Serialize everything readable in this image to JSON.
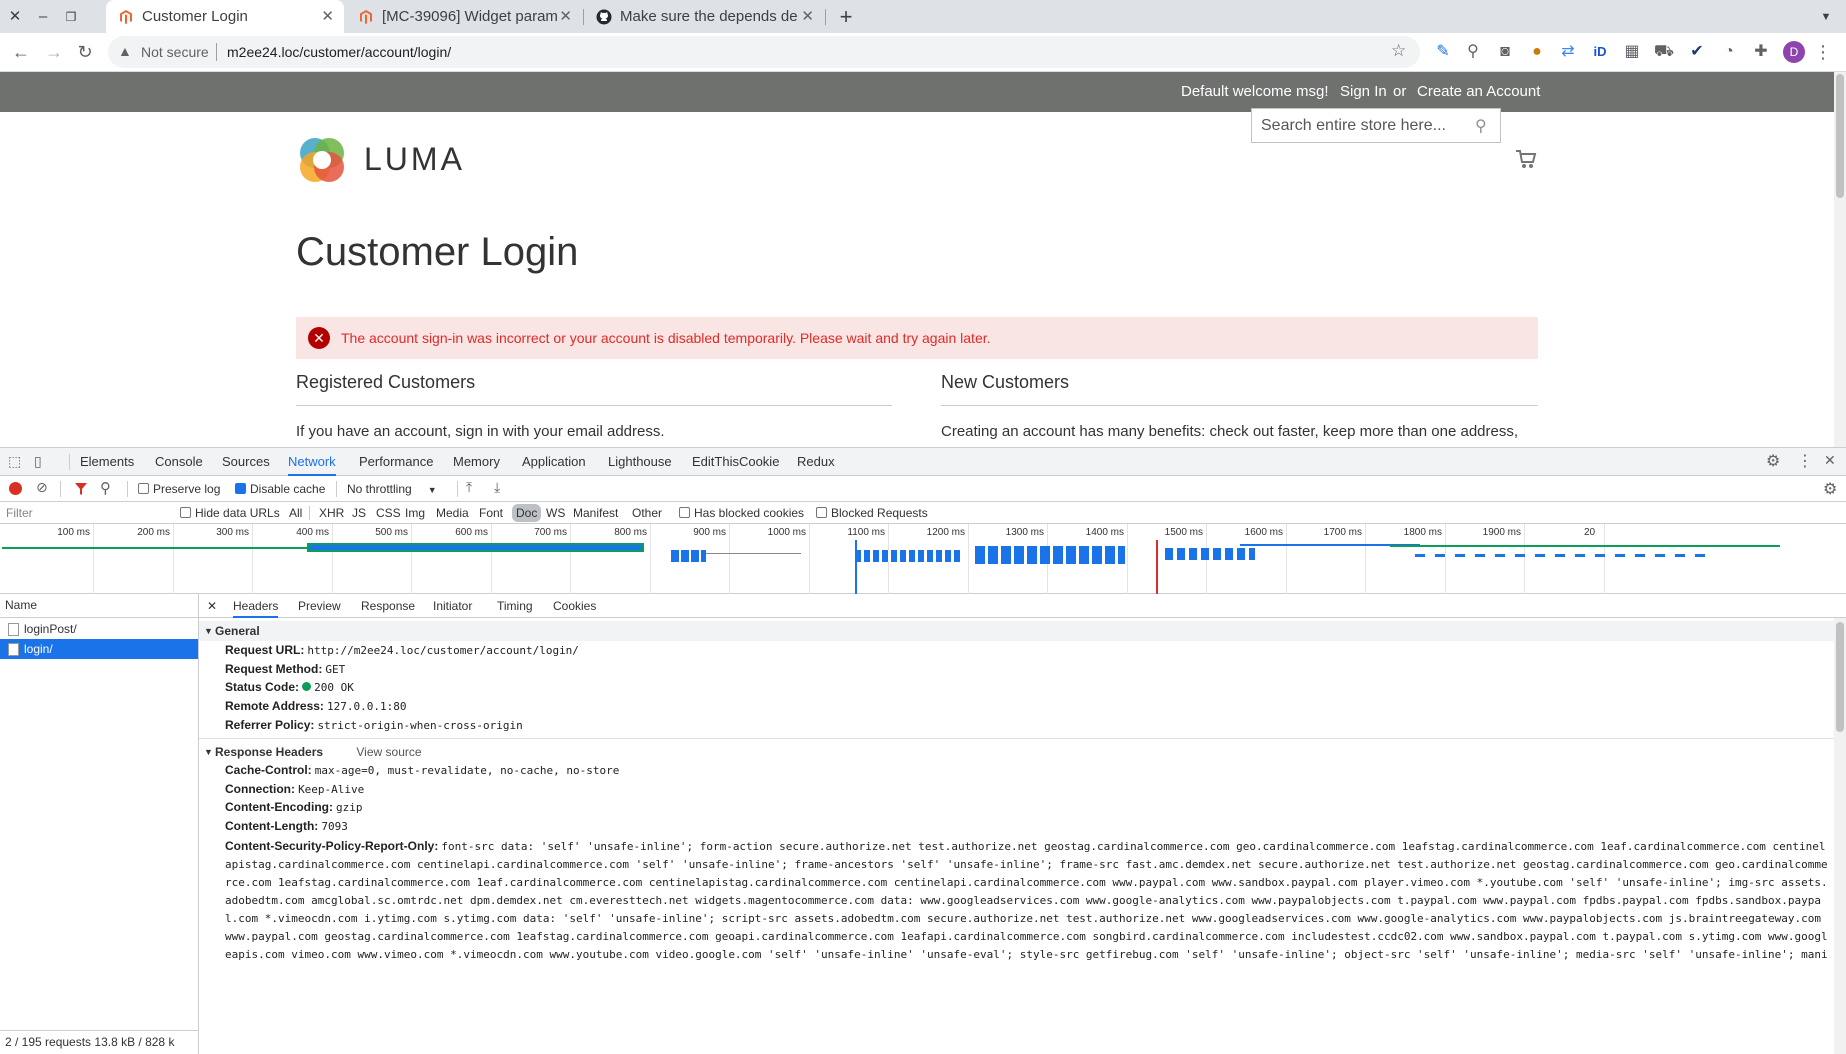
{
  "browser": {
    "tabs": [
      {
        "title": "Customer Login"
      },
      {
        "title": "[MC-39096] Widget param"
      },
      {
        "title": "Make sure the depends de"
      }
    ],
    "new_tab": "+",
    "security_label": "Not secure",
    "url": "m2ee24.loc/customer/account/login/",
    "profile_initial": "D"
  },
  "page": {
    "panel": {
      "welcome": "Default welcome msg!",
      "sign_in": "Sign In",
      "or": "or",
      "create_account": "Create an Account"
    },
    "logo_text": "LUMA",
    "search_placeholder": "Search entire store here...",
    "title": "Customer Login",
    "error_message": "The account sign-in was incorrect or your account is disabled temporarily. Please wait and try again later.",
    "registered": {
      "title": "Registered Customers",
      "text": "If you have an account, sign in with your email address."
    },
    "new_customers": {
      "title": "New Customers",
      "text": "Creating an account has many benefits: check out faster, keep more than one address,"
    }
  },
  "devtools": {
    "tabs": [
      "Elements",
      "Console",
      "Sources",
      "Network",
      "Performance",
      "Memory",
      "Application",
      "Lighthouse",
      "EditThisCookie",
      "Redux"
    ],
    "active_tab": "Network",
    "toolbar": {
      "preserve_log": "Preserve log",
      "disable_cache": "Disable cache",
      "throttling": "No throttling"
    },
    "filter": {
      "placeholder": "Filter",
      "hide_data_urls": "Hide data URLs",
      "types": [
        "All",
        "XHR",
        "JS",
        "CSS",
        "Img",
        "Media",
        "Font",
        "Doc",
        "WS",
        "Manifest",
        "Other"
      ],
      "active_type": "Doc",
      "has_blocked_cookies": "Has blocked cookies",
      "blocked_requests": "Blocked Requests"
    },
    "timeline_ticks": [
      "100 ms",
      "200 ms",
      "300 ms",
      "400 ms",
      "500 ms",
      "600 ms",
      "700 ms",
      "800 ms",
      "900 ms",
      "1000 ms",
      "1100 ms",
      "1200 ms",
      "1300 ms",
      "1400 ms",
      "1500 ms",
      "1600 ms",
      "1700 ms",
      "1800 ms",
      "1900 ms",
      "20"
    ],
    "name_header": "Name",
    "requests": [
      "loginPost/",
      "login/"
    ],
    "selected_request": "login/",
    "status_bar": "2 / 195 requests    13.8 kB / 828 k",
    "detail_tabs": [
      "Headers",
      "Preview",
      "Response",
      "Initiator",
      "Timing",
      "Cookies"
    ],
    "general": {
      "title": "General",
      "rows": [
        {
          "key": "Request URL:",
          "value": "http://m2ee24.loc/customer/account/login/"
        },
        {
          "key": "Request Method:",
          "value": "GET"
        },
        {
          "key": "Status Code:",
          "value": "200 OK"
        },
        {
          "key": "Remote Address:",
          "value": "127.0.0.1:80"
        },
        {
          "key": "Referrer Policy:",
          "value": "strict-origin-when-cross-origin"
        }
      ]
    },
    "response_headers": {
      "title": "Response Headers",
      "view_source": "View source",
      "rows": [
        {
          "key": "Cache-Control:",
          "value": "max-age=0, must-revalidate, no-cache, no-store"
        },
        {
          "key": "Connection:",
          "value": "Keep-Alive"
        },
        {
          "key": "Content-Encoding:",
          "value": "gzip"
        },
        {
          "key": "Content-Length:",
          "value": "7093"
        }
      ],
      "csp_key": "Content-Security-Policy-Report-Only:",
      "csp_value": "font-src data: 'self' 'unsafe-inline'; form-action secure.authorize.net test.authorize.net geostag.cardinalcommerce.com geo.cardinalcommerce.com 1eafstag.cardinalcommerce.com 1eaf.cardinalcommerce.com centinelapistag.cardinalcommerce.com centinelapi.cardinalcommerce.com 'self' 'unsafe-inline'; frame-ancestors 'self' 'unsafe-inline'; frame-src fast.amc.demdex.net secure.authorize.net test.authorize.net geostag.cardinalcommerce.com geo.cardinalcommerce.com 1eafstag.cardinalcommerce.com 1eaf.cardinalcommerce.com centinelapistag.cardinalcommerce.com centinelapi.cardinalcommerce.com www.paypal.com www.sandbox.paypal.com player.vimeo.com *.youtube.com 'self' 'unsafe-inline'; img-src assets.adobedtm.com amcglobal.sc.omtrdc.net dpm.demdex.net cm.everesttech.net widgets.magentocommerce.com data: www.googleadservices.com www.google-analytics.com www.paypalobjects.com t.paypal.com www.paypal.com fpdbs.paypal.com fpdbs.sandbox.paypal.com *.vimeocdn.com i.ytimg.com s.ytimg.com data: 'self' 'unsafe-inline'; script-src assets.adobedtm.com secure.authorize.net test.authorize.net www.googleadservices.com www.google-analytics.com www.paypalobjects.com js.braintreegateway.com www.paypal.com geostag.cardinalcommerce.com 1eafstag.cardinalcommerce.com geoapi.cardinalcommerce.com 1eafapi.cardinalcommerce.com songbird.cardinalcommerce.com includestest.ccdc02.com www.sandbox.paypal.com t.paypal.com s.ytimg.com www.googleapis.com vimeo.com www.vimeo.com *.vimeocdn.com www.youtube.com video.google.com 'self' 'unsafe-inline' 'unsafe-eval'; style-src getfirebug.com 'self' 'unsafe-inline'; object-src 'self' 'unsafe-inline'; media-src 'self' 'unsafe-inline'; mani"
    }
  },
  "colors": {
    "accent": "#1a73e8",
    "error_bg": "#fae5e5",
    "error_text": "#e02b27",
    "panel_bg": "#6e716e",
    "status_ok": "#0c9d58"
  }
}
